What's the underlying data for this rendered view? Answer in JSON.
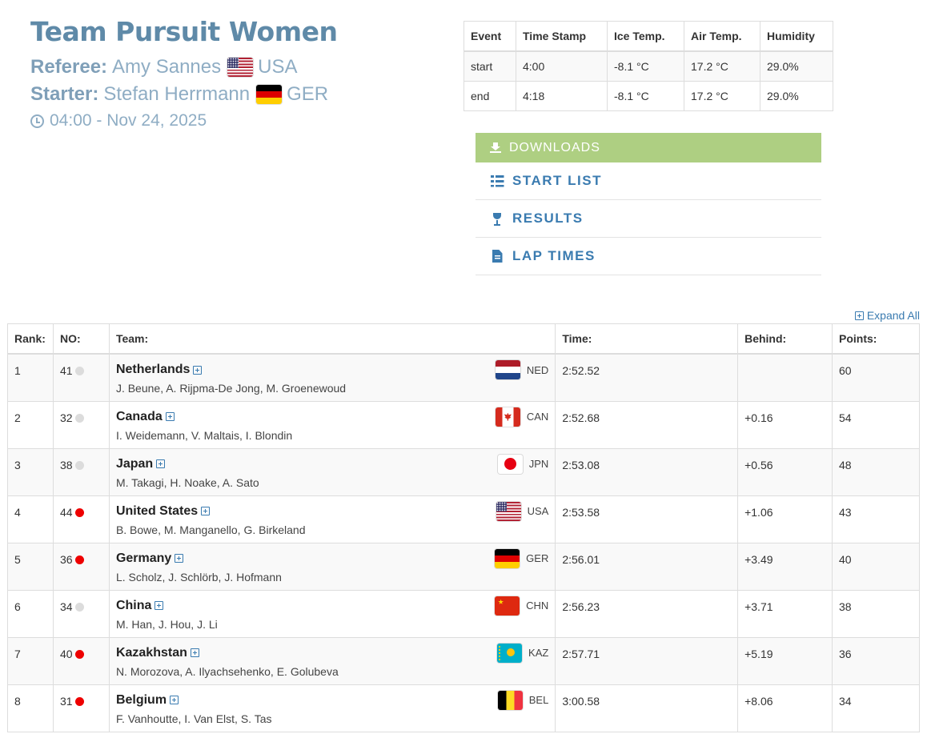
{
  "event": {
    "title": "Team Pursuit Women",
    "referee_label": "Referee:",
    "referee_name": "Amy Sannes",
    "referee_country": "USA",
    "starter_label": "Starter:",
    "starter_name": "Stefan Herrmann",
    "starter_country": "GER",
    "datetime": "04:00 - Nov 24, 2025"
  },
  "conditions": {
    "headers": [
      "Event",
      "Time Stamp",
      "Ice Temp.",
      "Air Temp.",
      "Humidity"
    ],
    "rows": [
      [
        "start",
        "4:00",
        "-8.1 °C",
        "17.2 °C",
        "29.0%"
      ],
      [
        "end",
        "4:18",
        "-8.1 °C",
        "17.2 °C",
        "29.0%"
      ]
    ]
  },
  "downloads": {
    "header": "DOWNLOADS",
    "items": [
      {
        "label": "START LIST",
        "icon": "list-ordered-icon"
      },
      {
        "label": "RESULTS",
        "icon": "trophy-icon"
      },
      {
        "label": "LAP TIMES",
        "icon": "file-text-icon"
      }
    ]
  },
  "expand_all": "Expand All",
  "results": {
    "headers": {
      "rank": "Rank:",
      "no": "NO:",
      "team": "Team:",
      "time": "Time:",
      "behind": "Behind:",
      "points": "Points:"
    },
    "rows": [
      {
        "rank": "1",
        "no": "41",
        "dot": "grey",
        "team": "Netherlands",
        "members": "J. Beune, A. Rijpma-De Jong, M. Groenewoud",
        "nation": "NED",
        "time": "2:52.52",
        "behind": "",
        "points": "60"
      },
      {
        "rank": "2",
        "no": "32",
        "dot": "grey",
        "team": "Canada",
        "members": "I. Weidemann, V. Maltais, I. Blondin",
        "nation": "CAN",
        "time": "2:52.68",
        "behind": "+0.16",
        "points": "54"
      },
      {
        "rank": "3",
        "no": "38",
        "dot": "grey",
        "team": "Japan",
        "members": "M. Takagi, H. Noake, A. Sato",
        "nation": "JPN",
        "time": "2:53.08",
        "behind": "+0.56",
        "points": "48"
      },
      {
        "rank": "4",
        "no": "44",
        "dot": "red",
        "team": "United States",
        "members": "B. Bowe, M. Manganello, G. Birkeland",
        "nation": "USA",
        "time": "2:53.58",
        "behind": "+1.06",
        "points": "43"
      },
      {
        "rank": "5",
        "no": "36",
        "dot": "red",
        "team": "Germany",
        "members": "L. Scholz, J. Schlörb, J. Hofmann",
        "nation": "GER",
        "time": "2:56.01",
        "behind": "+3.49",
        "points": "40"
      },
      {
        "rank": "6",
        "no": "34",
        "dot": "grey",
        "team": "China",
        "members": "M. Han, J. Hou, J. Li",
        "nation": "CHN",
        "time": "2:56.23",
        "behind": "+3.71",
        "points": "38"
      },
      {
        "rank": "7",
        "no": "40",
        "dot": "red",
        "team": "Kazakhstan",
        "members": "N. Morozova, A. Ilyachsehenko, E. Golubeva",
        "nation": "KAZ",
        "time": "2:57.71",
        "behind": "+5.19",
        "points": "36"
      },
      {
        "rank": "8",
        "no": "31",
        "dot": "red",
        "team": "Belgium",
        "members": "F. Vanhoutte, I. Van Elst, S. Tas",
        "nation": "BEL",
        "time": "3:00.58",
        "behind": "+8.06",
        "points": "34"
      }
    ]
  }
}
